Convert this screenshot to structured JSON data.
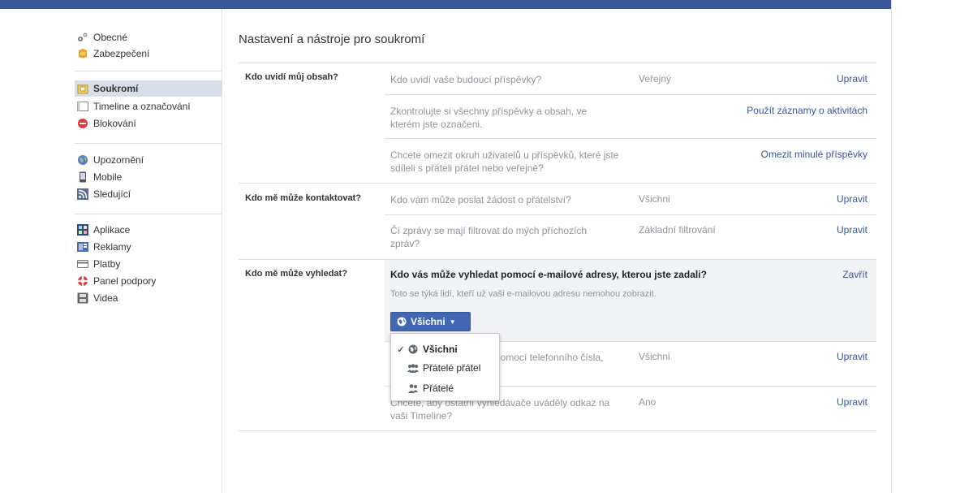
{
  "sidebar": {
    "groups": [
      [
        {
          "label": "Obecné",
          "icon": "gears-icon"
        },
        {
          "label": "Zabezpečení",
          "icon": "badge-icon"
        }
      ],
      [
        {
          "label": "Soukromí",
          "icon": "lock-icon",
          "selected": true
        },
        {
          "label": "Timeline a označování",
          "icon": "timeline-icon"
        },
        {
          "label": "Blokování",
          "icon": "block-icon"
        }
      ],
      [
        {
          "label": "Upozornění",
          "icon": "globe-icon"
        },
        {
          "label": "Mobile",
          "icon": "mobile-icon"
        },
        {
          "label": "Sledující",
          "icon": "rss-icon"
        }
      ],
      [
        {
          "label": "Aplikace",
          "icon": "apps-icon"
        },
        {
          "label": "Reklamy",
          "icon": "ads-icon"
        },
        {
          "label": "Platby",
          "icon": "card-icon"
        },
        {
          "label": "Panel podpory",
          "icon": "lifebuoy-icon"
        },
        {
          "label": "Videa",
          "icon": "film-icon"
        }
      ]
    ]
  },
  "main": {
    "title": "Nastavení a nástroje pro soukromí",
    "sections": [
      {
        "label": "Kdo uvidí můj obsah?",
        "rows": [
          {
            "question": "Kdo uvidí vaše budoucí příspěvky?",
            "value": "Veřejný",
            "action": "Upravit"
          },
          {
            "question": "Zkontrolujte si všechny příspěvky a obsah, ve kterém jste označeni.",
            "value": "",
            "action": "Použít záznamy o aktivitách"
          },
          {
            "question": "Chcete omezit okruh uživatelů u příspěvků, které jste sdíleli s přáteli přátel nebo veřejně?",
            "value": "",
            "action": "Omezit minulé příspěvky"
          }
        ]
      },
      {
        "label": "Kdo mě může kontaktovat?",
        "rows": [
          {
            "question": "Kdo vám může poslat žádost o přátelství?",
            "value": "Všichni",
            "action": "Upravit"
          },
          {
            "question": "Čí zprávy se mají filtrovat do mých příchozích zpráv?",
            "value": "Základní filtrování",
            "action": "Upravit"
          }
        ]
      },
      {
        "label": "Kdo mě může vyhledat?",
        "expanded": {
          "question": "Kdo vás může vyhledat pomocí e-mailové adresy, kterou jste zadali?",
          "description": "Toto se týká lidí, kteří už vaši e-mailovou adresu nemohou zobrazit.",
          "action": "Zavřít",
          "button_label": "Všichni"
        },
        "rows": [
          {
            "question": "pomocí telefonního čísla,",
            "value": "Všichni",
            "action": "Upravit"
          },
          {
            "question_line1": "Chcete, aby ostatní vyhledávače uváděly odkaz na",
            "question_line2": "vaši Timeline?",
            "value": "Ano",
            "action": "Upravit"
          }
        ]
      }
    ]
  },
  "dropdown": {
    "items": [
      {
        "label": "Všichni",
        "icon": "globe-icon",
        "checked": true
      },
      {
        "label": "Přátelé přátel",
        "icon": "friends-of-friends-icon",
        "checked": false
      },
      {
        "label": "Přátelé",
        "icon": "friends-icon",
        "checked": false
      }
    ],
    "check_glyph": "✓"
  },
  "colors": {
    "brand": "#3b5998",
    "link": "#365899",
    "button": "#4267b2"
  }
}
